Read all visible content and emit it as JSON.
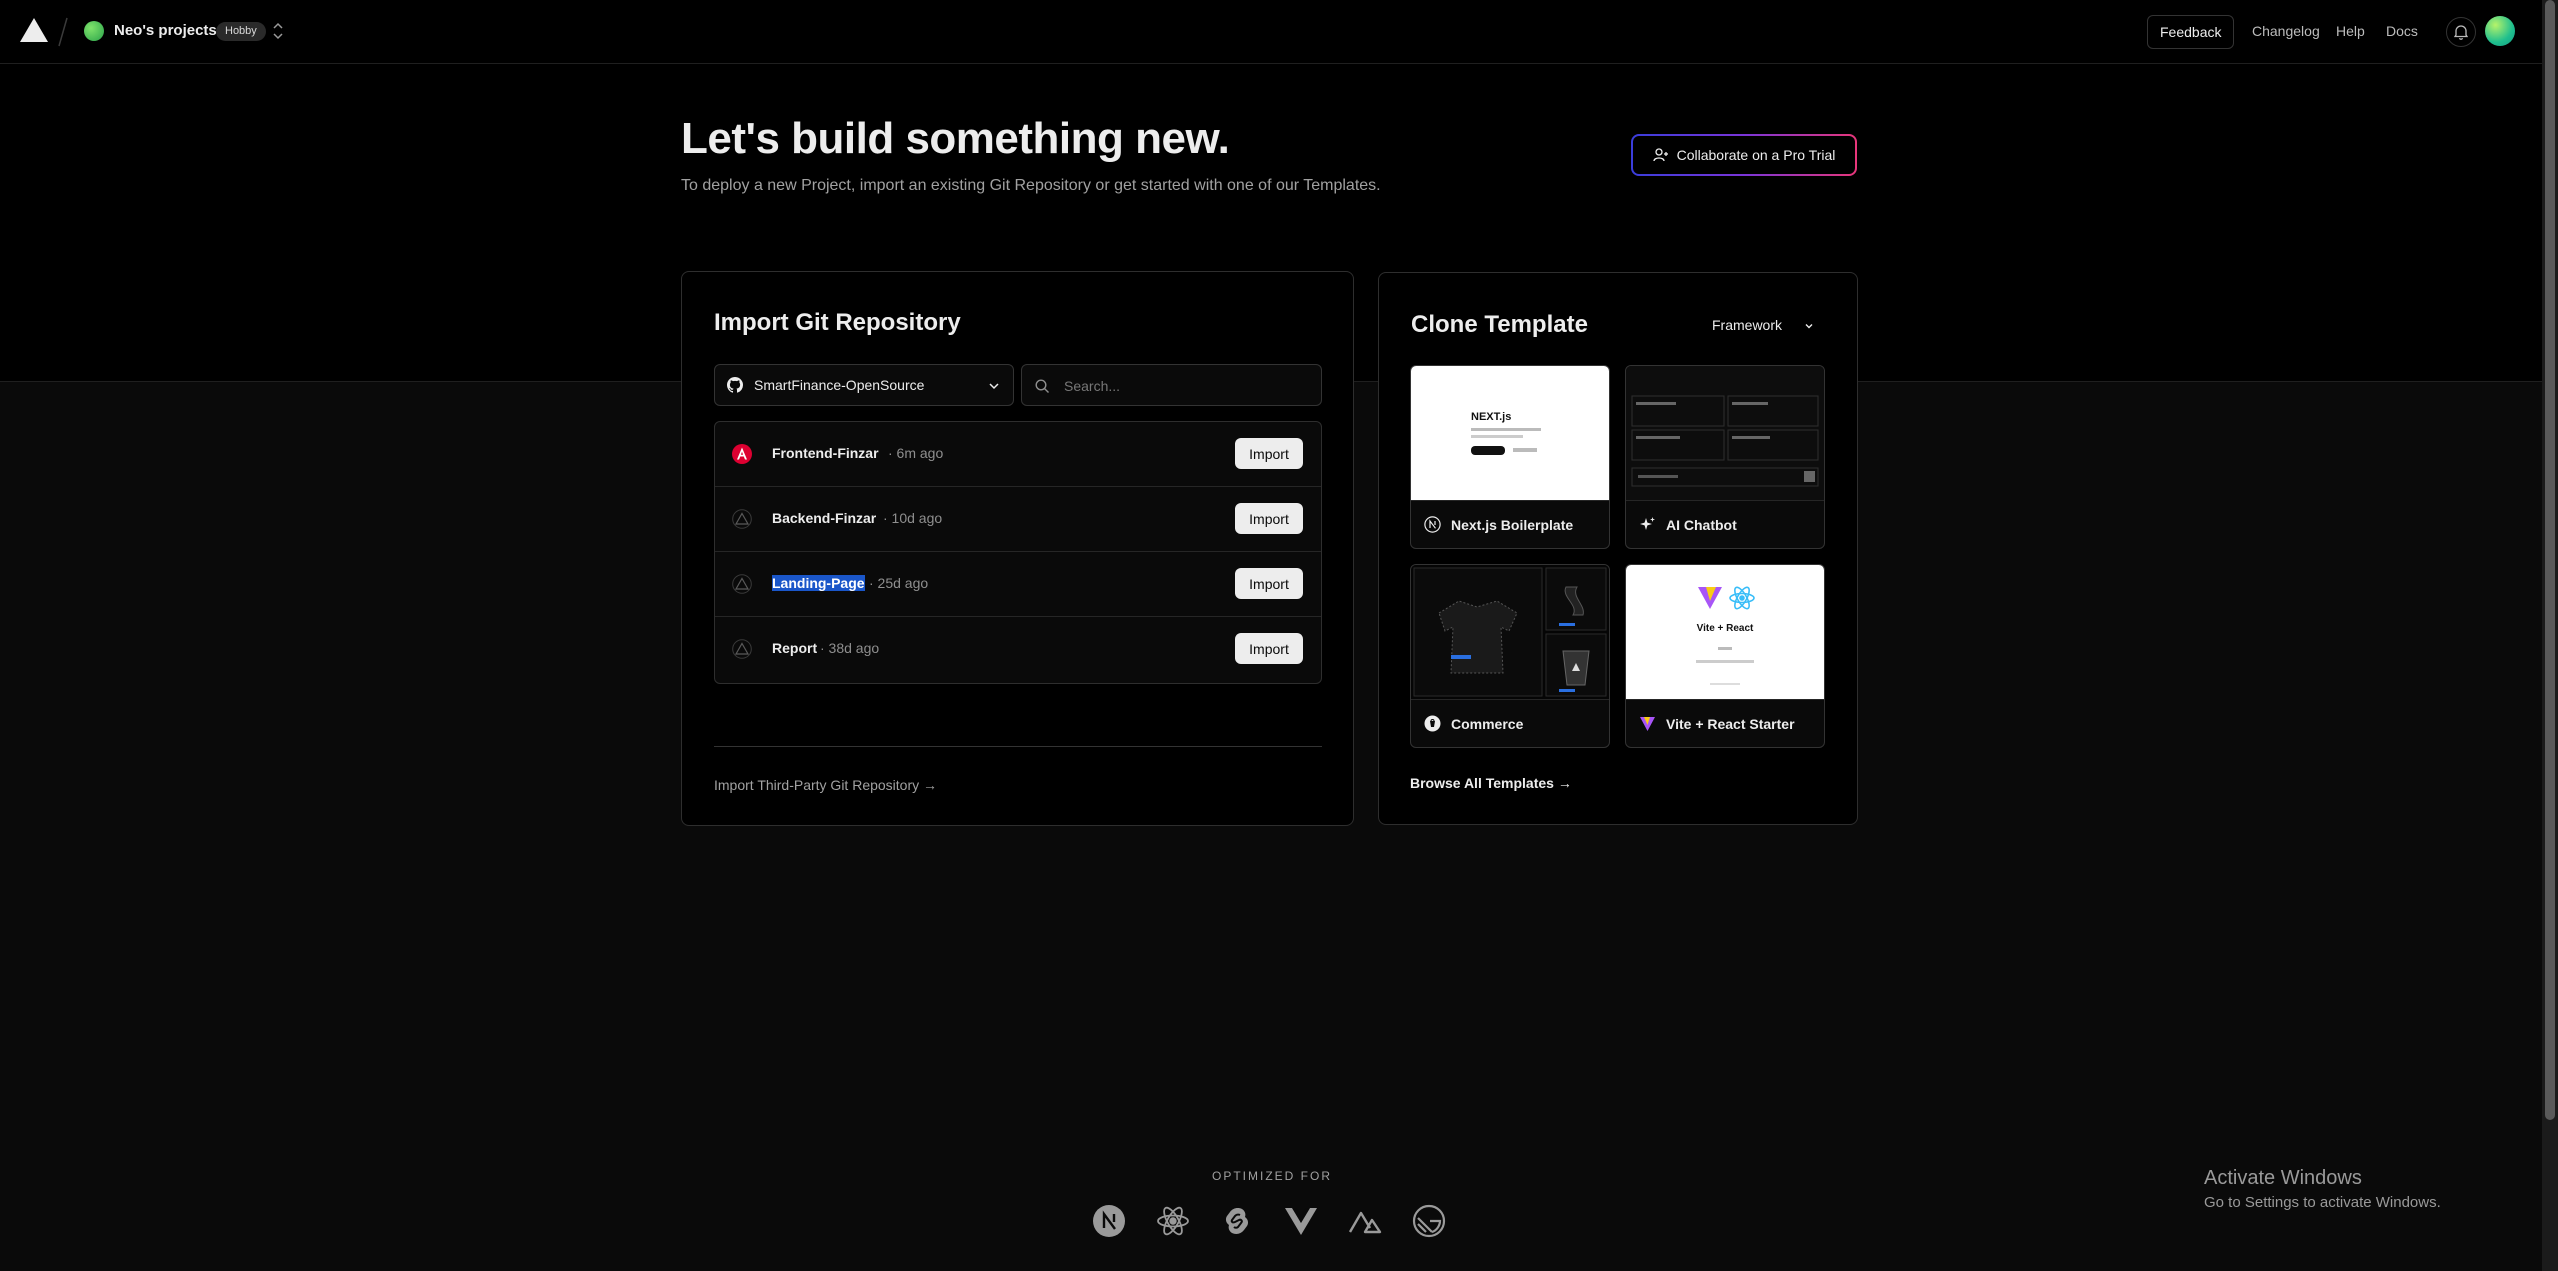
{
  "nav": {
    "team_name": "Neo's projects",
    "plan_badge": "Hobby",
    "feedback": "Feedback",
    "changelog": "Changelog",
    "help": "Help",
    "docs": "Docs"
  },
  "hero": {
    "title": "Let's build something new.",
    "subtitle": "To deploy a new Project, import an existing Git Repository or get started with one of our Templates.",
    "pro_trial_button": "Collaborate on a Pro Trial"
  },
  "import_panel": {
    "title": "Import Git Repository",
    "git_scope": "SmartFinance-OpenSource",
    "search_placeholder": "Search...",
    "repos": [
      {
        "name": "Frontend-Finzar",
        "time": "· 6m ago",
        "icon": "angular-icon",
        "button": "Import"
      },
      {
        "name": "Backend-Finzar",
        "time": "· 10d ago",
        "icon": "triangle-icon",
        "button": "Import"
      },
      {
        "name": "Landing-Page",
        "time": "· 25d ago",
        "icon": "triangle-icon",
        "button": "Import"
      },
      {
        "name": "Report",
        "time": "· 38d ago",
        "icon": "triangle-icon",
        "button": "Import"
      }
    ],
    "third_party_link": "Import Third-Party Git Repository →"
  },
  "clone_panel": {
    "title": "Clone Template",
    "framework_filter": "Framework",
    "templates": [
      {
        "name": "Next.js Boilerplate",
        "icon": "nextjs-icon"
      },
      {
        "name": "AI Chatbot",
        "icon": "sparkles-icon"
      },
      {
        "name": "Commerce",
        "icon": "commerce-icon"
      },
      {
        "name": "Vite + React Starter",
        "icon": "vite-icon"
      }
    ],
    "thumb_text": {
      "next_logo": "NEXT.js",
      "vite_react": "Vite + React"
    },
    "browse_link": "Browse All Templates →"
  },
  "footer": {
    "optimized_for": "OPTIMIZED FOR",
    "frameworks": [
      "nextjs-icon",
      "react-icon",
      "svelte-icon",
      "vue-icon",
      "nuxt-icon",
      "gatsby-icon"
    ]
  },
  "os_watermark": {
    "title": "Activate Windows",
    "subtitle": "Go to Settings to activate Windows."
  },
  "colors": {
    "background": "#0a0a0a",
    "selection": "#1a56c9",
    "angular_red": "#dd0031"
  }
}
